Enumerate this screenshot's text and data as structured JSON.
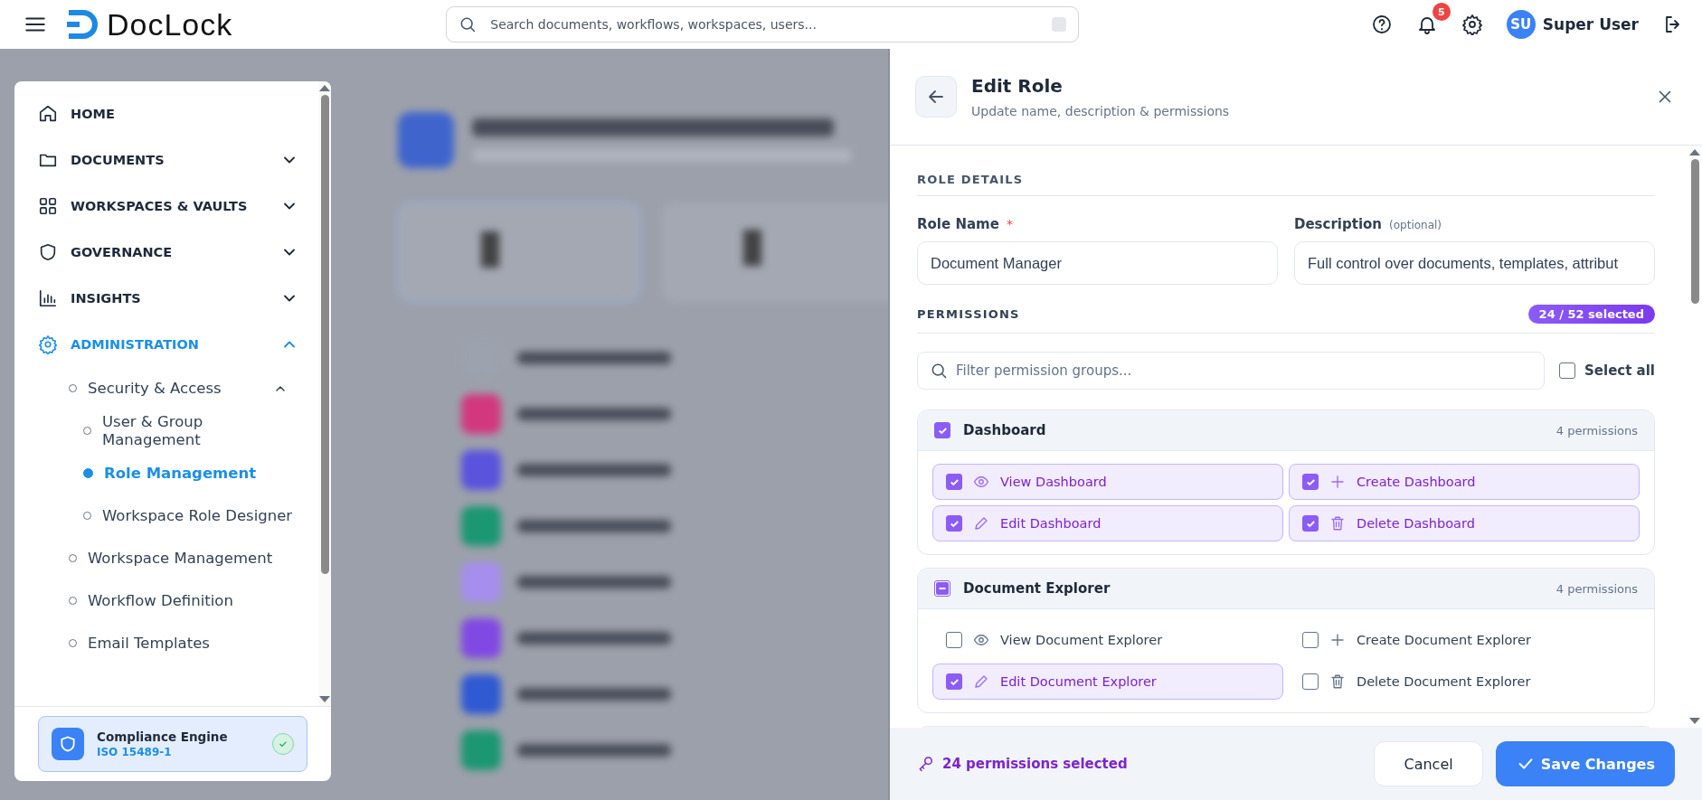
{
  "topbar": {
    "logo": "DocLock",
    "search": {
      "placeholder": "Search documents, workflows, workspaces, users..."
    },
    "notifications": "5",
    "user": {
      "initials": "SU",
      "name": "Super User"
    }
  },
  "sidebar": {
    "items": [
      {
        "label": "HOME",
        "expandable": false,
        "selected": false
      },
      {
        "label": "DOCUMENTS",
        "expandable": true,
        "expanded": false,
        "selected": false
      },
      {
        "label": "WORKSPACES & VAULTS",
        "expandable": true,
        "expanded": false,
        "selected": false
      },
      {
        "label": "GOVERNANCE",
        "expandable": true,
        "expanded": false,
        "selected": false
      },
      {
        "label": "INSIGHTS",
        "expandable": true,
        "expanded": false,
        "selected": false
      },
      {
        "label": "ADMINISTRATION",
        "expandable": true,
        "expanded": true,
        "selected": true,
        "children": [
          {
            "label": "Security & Access",
            "expandable": true,
            "expanded": true,
            "selected": false,
            "children": [
              {
                "label": "User & Group Management",
                "selected": false
              },
              {
                "label": "Role Management",
                "selected": true
              },
              {
                "label": "Workspace Role Designer",
                "selected": false
              }
            ]
          },
          {
            "label": "Workspace Management",
            "expandable": false,
            "selected": false
          },
          {
            "label": "Workflow Definition",
            "expandable": false,
            "selected": false
          },
          {
            "label": "Email Templates",
            "expandable": false,
            "selected": false
          }
        ]
      }
    ],
    "compliance": {
      "title": "Compliance Engine",
      "subtitle": "ISO 15489-1",
      "ok": true
    }
  },
  "panel": {
    "title": "Edit Role",
    "subtitle": "Update name, description & permissions",
    "role_details": {
      "heading": "ROLE DETAILS",
      "name_label": "Role Name",
      "required_mark": "*",
      "name_value": "Document Manager",
      "description_label": "Description",
      "description_hint": "(optional)",
      "description_value": "Full control over documents, templates, attribut"
    },
    "permissions": {
      "heading": "PERMISSIONS",
      "badge": "24 / 52 selected",
      "filter": {
        "placeholder": "Filter permission groups..."
      },
      "select_all": {
        "label": "Select all",
        "checked": false
      },
      "groups": [
        {
          "name": "Dashboard",
          "count": "4 permissions",
          "checked": true,
          "indeterminate": false,
          "items": [
            {
              "label": "View Dashboard",
              "kind": "view",
              "checked": true
            },
            {
              "label": "Create Dashboard",
              "kind": "create",
              "checked": true
            },
            {
              "label": "Edit Dashboard",
              "kind": "edit",
              "checked": true
            },
            {
              "label": "Delete Dashboard",
              "kind": "delete",
              "checked": true
            }
          ]
        },
        {
          "name": "Document Explorer",
          "count": "4 permissions",
          "checked": false,
          "indeterminate": true,
          "items": [
            {
              "label": "View Document Explorer",
              "kind": "view",
              "checked": false
            },
            {
              "label": "Create Document Explorer",
              "kind": "create",
              "checked": false
            },
            {
              "label": "Edit Document Explorer",
              "kind": "edit",
              "checked": true
            },
            {
              "label": "Delete Document Explorer",
              "kind": "delete",
              "checked": false
            }
          ]
        }
      ]
    },
    "footer": {
      "summary": "24 permissions selected",
      "cancel": "Cancel",
      "save": "Save Changes"
    }
  }
}
